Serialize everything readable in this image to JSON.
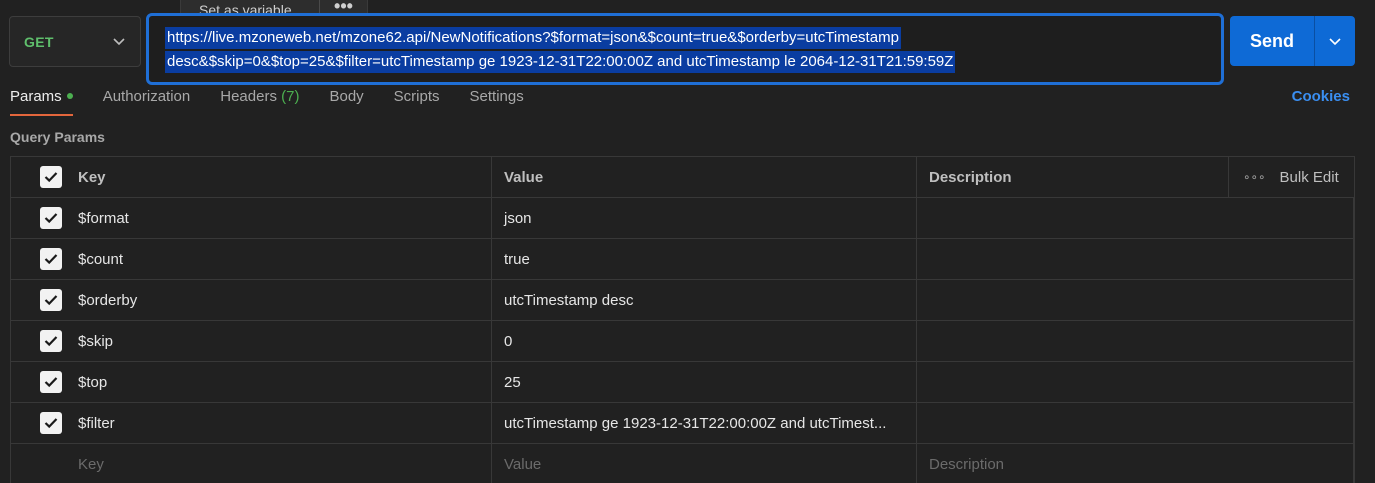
{
  "tooltip": {
    "label": "Set as variable",
    "more": "•••"
  },
  "request": {
    "method": "GET",
    "url_lines": [
      "https://live.mzoneweb.net/mzone62.api/NewNotifications?$format=json&$count=true&$orderby=utcTimestamp",
      "desc&$skip=0&$top=25&$filter=utcTimestamp ge 1923-12-31T22:00:00Z and utcTimestamp le 2064-12-31T21:59:59Z"
    ],
    "send_label": "Send"
  },
  "tabs": {
    "params": "Params",
    "authorization": "Authorization",
    "headers": "Headers",
    "headers_count": "(7)",
    "body": "Body",
    "scripts": "Scripts",
    "settings": "Settings",
    "cookies": "Cookies"
  },
  "query_params": {
    "title": "Query Params",
    "columns": {
      "key": "Key",
      "value": "Value",
      "description": "Description",
      "bulk_edit": "Bulk Edit",
      "more": "∘∘∘"
    },
    "rows": [
      {
        "key": "$format",
        "value": "json",
        "description": "",
        "checked": true
      },
      {
        "key": "$count",
        "value": "true",
        "description": "",
        "checked": true
      },
      {
        "key": "$orderby",
        "value": "utcTimestamp desc",
        "description": "",
        "checked": true
      },
      {
        "key": "$skip",
        "value": "0",
        "description": "",
        "checked": true
      },
      {
        "key": "$top",
        "value": "25",
        "description": "",
        "checked": true
      },
      {
        "key": "$filter",
        "value": "utcTimestamp ge 1923-12-31T22:00:00Z and utcTimest...",
        "description": "",
        "checked": true
      }
    ],
    "new_row": {
      "key_placeholder": "Key",
      "value_placeholder": "Value",
      "description_placeholder": "Description"
    }
  },
  "colors": {
    "accent": "#0e6ad6",
    "method": "#5fbf6c",
    "tab_indicator": "#e3663c",
    "count": "#4caf50",
    "link": "#3a8ef0"
  }
}
